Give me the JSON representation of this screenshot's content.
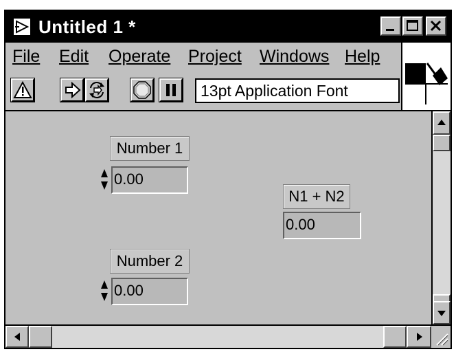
{
  "window": {
    "title": "Untitled 1 *",
    "controls": [
      "minimize-icon",
      "maximize-icon",
      "close-icon"
    ]
  },
  "menu": {
    "file": "File",
    "edit": "Edit",
    "operate": "Operate",
    "project": "Project",
    "windows": "Windows",
    "help": "Help"
  },
  "toolbar": {
    "buttons": [
      "warning-icon",
      "run-arrow-icon",
      "run-continuously-icon",
      "abort-icon",
      "pause-icon"
    ],
    "font_ring": "13pt Application Font"
  },
  "panel": {
    "number1": {
      "label": "Number 1",
      "value": "0.00"
    },
    "number2": {
      "label": "Number 2",
      "value": "0.00"
    },
    "result": {
      "label": "N1 + N2",
      "value": "0.00"
    }
  }
}
